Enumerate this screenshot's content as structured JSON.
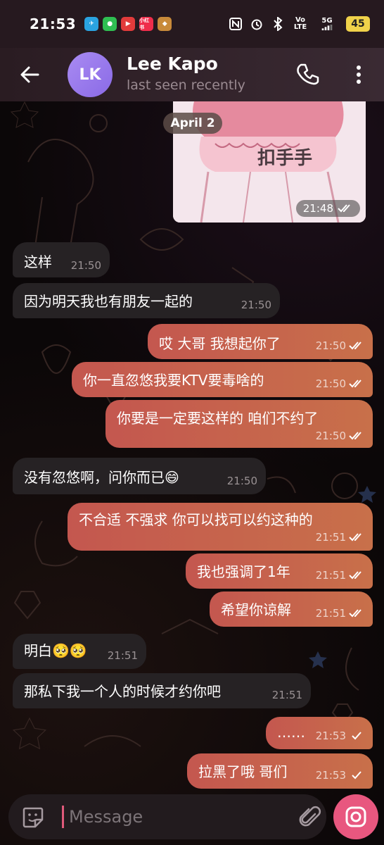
{
  "status_bar": {
    "time": "21:53",
    "battery": "45",
    "network_label": "5G",
    "volte_label": "Vo LTE",
    "app_labels": [
      "小红书"
    ]
  },
  "header": {
    "avatar_initials": "LK",
    "contact_name": "Lee Kapo",
    "contact_status": "last seen recently"
  },
  "chat": {
    "date_chip": "April 2",
    "image_message": {
      "caption": "扣手手",
      "time": "21:48"
    },
    "messages": [
      {
        "dir": "in",
        "text": "这样",
        "time": "21:50"
      },
      {
        "dir": "in",
        "text": "因为明天我也有朋友一起的",
        "time": "21:50"
      },
      {
        "dir": "out",
        "text": "哎 大哥 我想起你了",
        "time": "21:50"
      },
      {
        "dir": "out",
        "text": "你一直忽悠我要KTV要毒啥的",
        "time": "21:50"
      },
      {
        "dir": "out",
        "text": "你要是一定要这样的 咱们不约了",
        "time": "21:50"
      },
      {
        "dir": "in",
        "text": "没有忽悠啊，问你而已😄",
        "time": "21:50"
      },
      {
        "dir": "out",
        "text": "不合适 不强求 你可以找可以约这种的",
        "time": "21:51"
      },
      {
        "dir": "out",
        "text": "我也强调了1年",
        "time": "21:51"
      },
      {
        "dir": "out",
        "text": "希望你谅解",
        "time": "21:51"
      },
      {
        "dir": "in",
        "text": "明白🥺🥺",
        "time": "21:51"
      },
      {
        "dir": "in",
        "text": "那私下我一个人的时候才约你吧",
        "time": "21:51"
      },
      {
        "dir": "out",
        "text": "……",
        "time": "21:53"
      },
      {
        "dir": "out",
        "text": "拉黑了哦 哥们",
        "time": "21:53"
      }
    ]
  },
  "composer": {
    "placeholder": "Message"
  },
  "colors": {
    "outgoing_bubble": "#c4574f",
    "incoming_bubble": "#262224",
    "accent": "#e8577f",
    "avatar": "#9b7cee"
  }
}
